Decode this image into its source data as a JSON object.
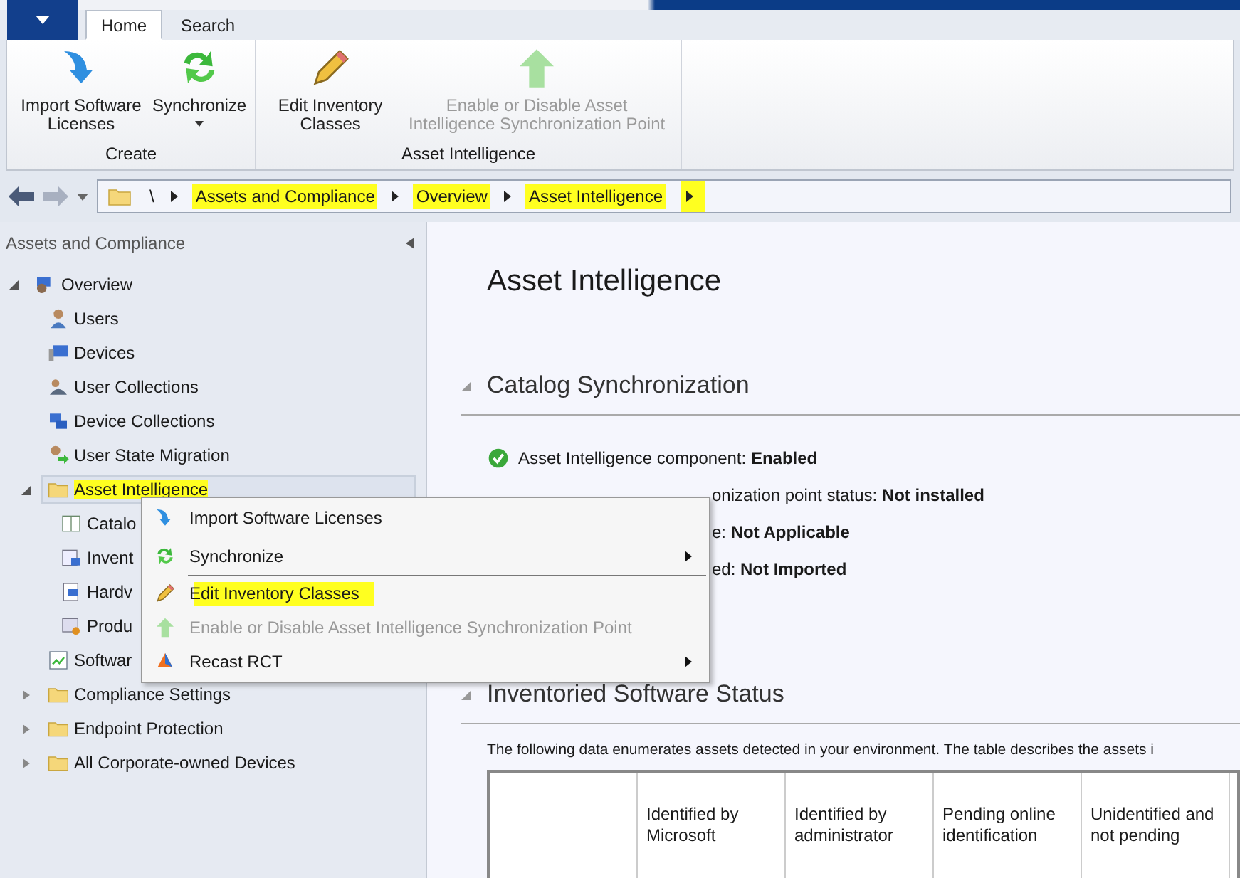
{
  "ribbon": {
    "tabs": [
      {
        "label": "Home",
        "selected": true
      },
      {
        "label": "Search",
        "selected": false
      }
    ],
    "groups": [
      {
        "label": "Create",
        "buttons": [
          {
            "label": "Import Software Licenses",
            "kind": "import",
            "disabled": false,
            "dropdown": false
          },
          {
            "label": "Synchronize",
            "kind": "sync",
            "disabled": false,
            "dropdown": true
          }
        ]
      },
      {
        "label": "Asset Intelligence",
        "buttons": [
          {
            "label": "Edit Inventory Classes",
            "kind": "pencil",
            "disabled": false,
            "dropdown": false
          },
          {
            "label": "Enable or Disable Asset Intelligence Synchronization Point",
            "kind": "up",
            "disabled": true,
            "dropdown": false
          }
        ]
      }
    ]
  },
  "breadcrumb": [
    {
      "label": "\\",
      "highlighted": false
    },
    {
      "label": "Assets and Compliance",
      "highlighted": true
    },
    {
      "label": "Overview",
      "highlighted": true
    },
    {
      "label": "Asset Intelligence",
      "highlighted": true
    }
  ],
  "sidebar": {
    "title": "Assets and Compliance",
    "tree": [
      {
        "label": "Overview",
        "kind": "overview",
        "expanded": true,
        "highlighted": false,
        "children": [
          {
            "label": "Users",
            "kind": "user",
            "highlighted": false
          },
          {
            "label": "Devices",
            "kind": "device",
            "highlighted": false
          },
          {
            "label": "User Collections",
            "kind": "user-collection",
            "highlighted": false
          },
          {
            "label": "Device Collections",
            "kind": "device-collection",
            "highlighted": false
          },
          {
            "label": "User State Migration",
            "kind": "migration",
            "highlighted": false
          },
          {
            "label": "Asset Intelligence",
            "kind": "folder",
            "expanded": true,
            "highlighted": true,
            "children": [
              {
                "label": "Catalo",
                "kind": "catalog",
                "highlighted": false
              },
              {
                "label": "Invent",
                "kind": "inventory",
                "highlighted": false
              },
              {
                "label": "Hardv",
                "kind": "hardware",
                "highlighted": false
              },
              {
                "label": "Produ",
                "kind": "product",
                "highlighted": false
              }
            ]
          },
          {
            "label": "Softwar",
            "kind": "software",
            "highlighted": false
          },
          {
            "label": "Compliance Settings",
            "kind": "folder",
            "expanded": false,
            "highlighted": false
          },
          {
            "label": "Endpoint Protection",
            "kind": "folder",
            "expanded": false,
            "highlighted": false
          },
          {
            "label": "All Corporate-owned Devices",
            "kind": "folder",
            "expanded": false,
            "highlighted": false
          }
        ]
      }
    ]
  },
  "content": {
    "title": "Asset Intelligence",
    "sections": [
      {
        "heading": "Catalog Synchronization",
        "expanded": true,
        "status": [
          {
            "kind": "ok",
            "text": "Asset Intelligence component: **Enabled**"
          },
          {
            "kind": "covered",
            "text": "onization point status: **Not installed**"
          },
          {
            "kind": "covered",
            "text": "e: **Not Applicable**"
          },
          {
            "kind": "covered",
            "text": "ed: **Not Imported**"
          }
        ]
      },
      {
        "heading": "Inventoried Software Status",
        "expanded": true,
        "description": "The following data enumerates assets detected in your environment. The table describes the assets i",
        "table": {
          "columns": [
            "",
            "Identified by Microsoft",
            "Identified by administrator",
            "Pending online identification",
            "Unidentified and not pending"
          ]
        }
      }
    ]
  },
  "context_menu": [
    {
      "label": "Import Software Licenses",
      "kind": "import",
      "disabled": false,
      "highlighted": false,
      "submenu": false,
      "separator_after": false
    },
    {
      "label": "Synchronize",
      "kind": "sync",
      "disabled": false,
      "highlighted": false,
      "submenu": true,
      "separator_after": true
    },
    {
      "label": "Edit Inventory Classes",
      "kind": "pencil",
      "disabled": false,
      "highlighted": true,
      "submenu": false,
      "separator_after": false
    },
    {
      "label": "Enable or Disable Asset Intelligence Synchronization Point",
      "kind": "up",
      "disabled": true,
      "highlighted": false,
      "submenu": false,
      "separator_after": false
    },
    {
      "label": "Recast RCT",
      "kind": "recast",
      "disabled": false,
      "highlighted": false,
      "submenu": true,
      "separator_after": false
    }
  ]
}
